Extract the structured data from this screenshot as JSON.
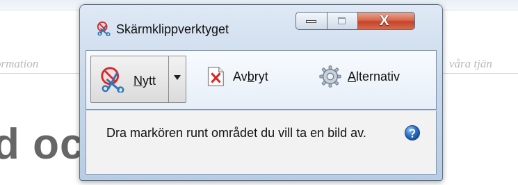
{
  "background": {
    "left_text": "ormation",
    "right_text": "våra tjän",
    "heading": "d oc"
  },
  "window": {
    "title": "Skärmklippverktyget",
    "caption": {
      "close": "X"
    }
  },
  "toolbar": {
    "new_prefix": "",
    "new_underline": "N",
    "new_suffix": "ytt",
    "cancel_prefix": "Av",
    "cancel_underline": "b",
    "cancel_suffix": "ryt",
    "options_underline": "A",
    "options_suffix": "lternativ"
  },
  "content": {
    "instruction": "Dra markören runt området du vill ta en bild av."
  },
  "icons": {
    "title": "scissors-icon",
    "new": "new-snip-scissors-icon",
    "dropdown": "chevron-down-icon",
    "cancel": "cancel-x-icon",
    "options": "gear-icon",
    "help": "help-icon"
  },
  "colors": {
    "window_frame": "#b7cde4",
    "close_button": "#c7422b",
    "content_bg": "#f2f2f2",
    "help_blue": "#245fb8"
  }
}
